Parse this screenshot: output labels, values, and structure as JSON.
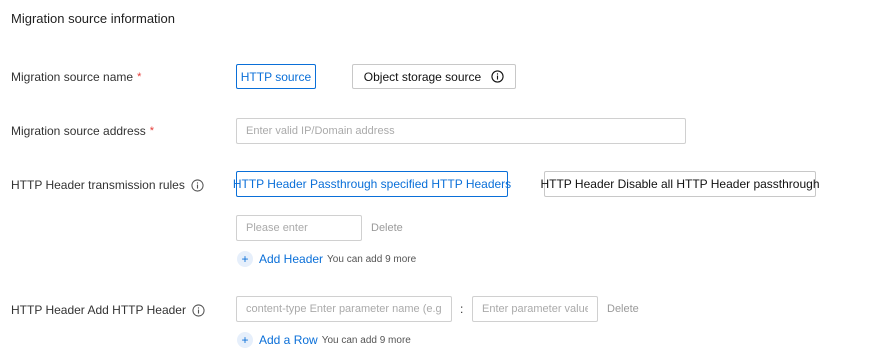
{
  "section": {
    "title": "Migration source information"
  },
  "source_name": {
    "label": "Migration source name",
    "required_mark": "*",
    "options": [
      "HTTP source",
      "Object storage source"
    ],
    "selected": "HTTP source"
  },
  "source_address": {
    "label": "Migration source address",
    "required_mark": "*",
    "placeholder": "Enter valid IP/Domain address",
    "value": ""
  },
  "transmission_rules": {
    "label": "HTTP Header transmission rules",
    "options": [
      "HTTP Header Passthrough specified HTTP Headers",
      "HTTP Header Disable all HTTP Header passthrough"
    ],
    "selected": "HTTP Header Passthrough specified HTTP Headers",
    "header_input_placeholder": "Please enter",
    "delete_label": "Delete",
    "add_label": "Add Header",
    "add_hint": "You can add 9 more"
  },
  "add_header": {
    "label": "HTTP Header Add HTTP Header",
    "name_placeholder": "content-type Enter parameter name (e.g.",
    "separator": ":",
    "value_placeholder": "Enter parameter value",
    "delete_label": "Delete",
    "add_label": "Add a Row",
    "add_hint": "You can add 9 more"
  },
  "icons": [
    "info-icon",
    "plus-icon"
  ],
  "colors": {
    "accent": "#0a6fd8",
    "required": "#e53935",
    "border": "#c8c8c8",
    "muted_text": "#9a9a9a"
  }
}
